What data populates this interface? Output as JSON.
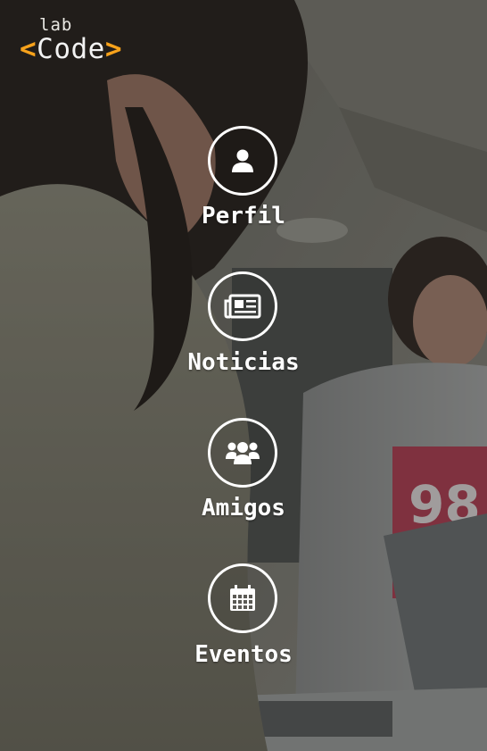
{
  "brand": {
    "lab": "lab",
    "code_open": "<",
    "code_word": "Code",
    "code_close": ">",
    "accent_color": "#f7a21b"
  },
  "menu": {
    "items": [
      {
        "label": "Perfil",
        "icon": "user-icon"
      },
      {
        "label": "Noticias",
        "icon": "newspaper-icon"
      },
      {
        "label": "Amigos",
        "icon": "users-icon"
      },
      {
        "label": "Eventos",
        "icon": "calendar-icon"
      }
    ]
  }
}
